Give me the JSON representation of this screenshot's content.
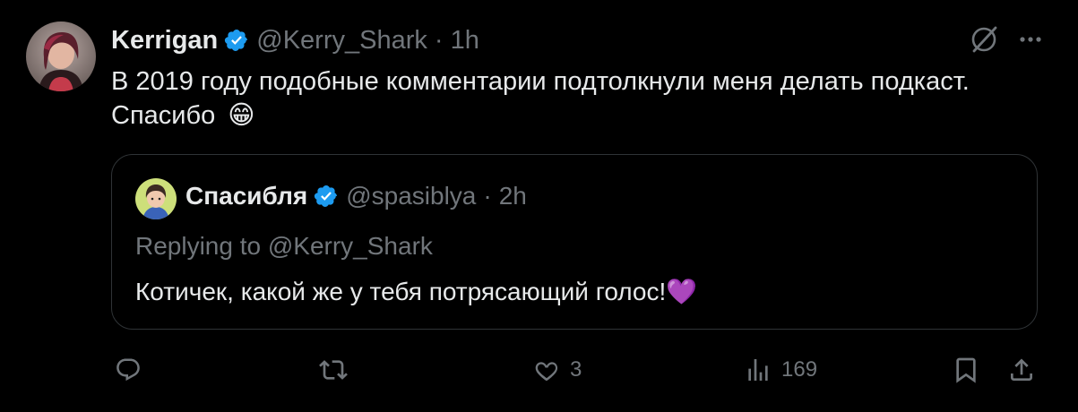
{
  "tweet": {
    "author_name": "Kerrigan",
    "author_handle": "@Kerry_Shark",
    "separator": "·",
    "time": "1h",
    "text": "В 2019 году подобные комментарии подтолкнули меня делать подкаст. Спасибо",
    "emoji": "😁"
  },
  "quote": {
    "author_name": "Спасибля",
    "author_handle": "@spasiblya",
    "separator": "·",
    "time": "2h",
    "replying_to": "Replying to @Kerry_Shark",
    "text": "Котичек, какой же у тебя потрясающий голос!",
    "emoji": "💜"
  },
  "actions": {
    "reply_count": "",
    "retweet_count": "",
    "like_count": "3",
    "views_count": "169"
  },
  "colors": {
    "background": "#000000",
    "text": "#e7e9ea",
    "muted": "#71767b",
    "border": "#2f3336",
    "verified": "#1d9bf0"
  },
  "icons": [
    "verified-badge-icon",
    "grok-icon",
    "more-icon",
    "reply-icon",
    "retweet-icon",
    "like-icon",
    "views-icon",
    "bookmark-icon",
    "share-icon"
  ]
}
